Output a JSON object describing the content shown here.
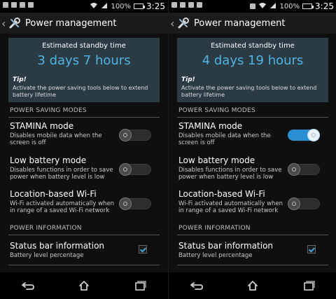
{
  "panels": [
    {
      "status_bar": {
        "battery_percent": "100%",
        "time": "3:25"
      },
      "action_bar": {
        "title": "Power management"
      },
      "standby": {
        "label": "Estimated standby time",
        "value": "3 days 7 hours",
        "tip_title": "Tip!",
        "tip_text": "Activate the power saving tools below to extend battery lifetime"
      },
      "sections": {
        "power_saving_modes": "POWER SAVING MODES",
        "power_information": "POWER INFORMATION"
      },
      "items": {
        "stamina": {
          "title": "STAMINA mode",
          "desc": "Disables mobile data when the screen is off",
          "state": "off"
        },
        "low_battery": {
          "title": "Low battery mode",
          "desc": "Disables functions in order to save power when battery level is low",
          "state": "off"
        },
        "wifi": {
          "title": "Location-based Wi-Fi",
          "desc": "Wi-Fi activated automatically when in range of a saved Wi-Fi network",
          "state": "off"
        },
        "status_info": {
          "title": "Status bar information",
          "desc": "Battery level percentage",
          "checked": true
        }
      }
    },
    {
      "status_bar": {
        "battery_percent": "100%",
        "time": "3:25"
      },
      "action_bar": {
        "title": "Power management"
      },
      "standby": {
        "label": "Estimated standby time",
        "value": "4 days 19 hours",
        "tip_title": "Tip!",
        "tip_text": "Activate the power saving tools below to extend battery lifetime"
      },
      "sections": {
        "power_saving_modes": "POWER SAVING MODES",
        "power_information": "POWER INFORMATION"
      },
      "items": {
        "stamina": {
          "title": "STAMINA mode",
          "desc": "Disables mobile data when the screen is off",
          "state": "on"
        },
        "low_battery": {
          "title": "Low battery mode",
          "desc": "Disables functions in order to save power when battery level is low",
          "state": "off"
        },
        "wifi": {
          "title": "Location-based Wi-Fi",
          "desc": "Wi-Fi activated automatically when in range of a saved Wi-Fi network",
          "state": "off"
        },
        "status_info": {
          "title": "Status bar information",
          "desc": "Battery level percentage",
          "checked": true
        }
      }
    }
  ],
  "colors": {
    "accent": "#4fb3e5",
    "toggle_on": "#2b8fd3",
    "card_bg": "#2b3b44",
    "background": "#0f0f0f"
  },
  "icons": {
    "action_bar": "wrench-screwdriver-icon",
    "nav": [
      "back-icon",
      "home-icon",
      "recent-apps-icon"
    ]
  }
}
